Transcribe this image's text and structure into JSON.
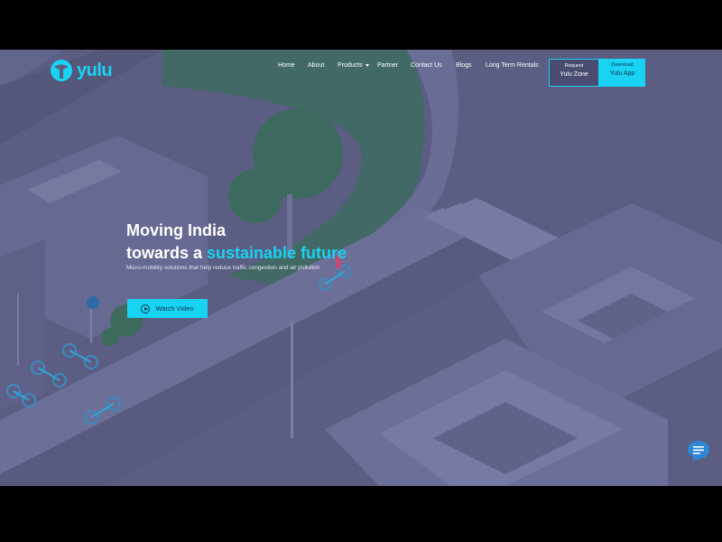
{
  "brand": {
    "name": "yulu"
  },
  "nav": {
    "items": [
      {
        "label": "Home"
      },
      {
        "label": "About"
      },
      {
        "label": "Products",
        "dropdown": true
      },
      {
        "label": "Partner"
      },
      {
        "label": "Contact Us"
      },
      {
        "label": "Blogs"
      },
      {
        "label": "Long Term Rentals"
      }
    ]
  },
  "cta": {
    "zone": {
      "small": "Request",
      "main": "Yulu Zone"
    },
    "app": {
      "small": "Download",
      "main": "Yulu App"
    }
  },
  "hero": {
    "line1": "Moving India",
    "line2_prefix": "towards a ",
    "line2_accent": "sustainable future",
    "subtitle": "Micro-mobility solutions that help reduce traffic congestion and air pollution",
    "watch_label": "Watch Video"
  },
  "icons": {
    "logo": "yulu-logo-icon",
    "play": "play-icon",
    "chat": "chat-icon",
    "caret": "chevron-down-icon"
  },
  "colors": {
    "accent": "#19d3f2",
    "overlay": "#5b5d83",
    "text": "#ffffff",
    "button_text": "#12324a"
  }
}
